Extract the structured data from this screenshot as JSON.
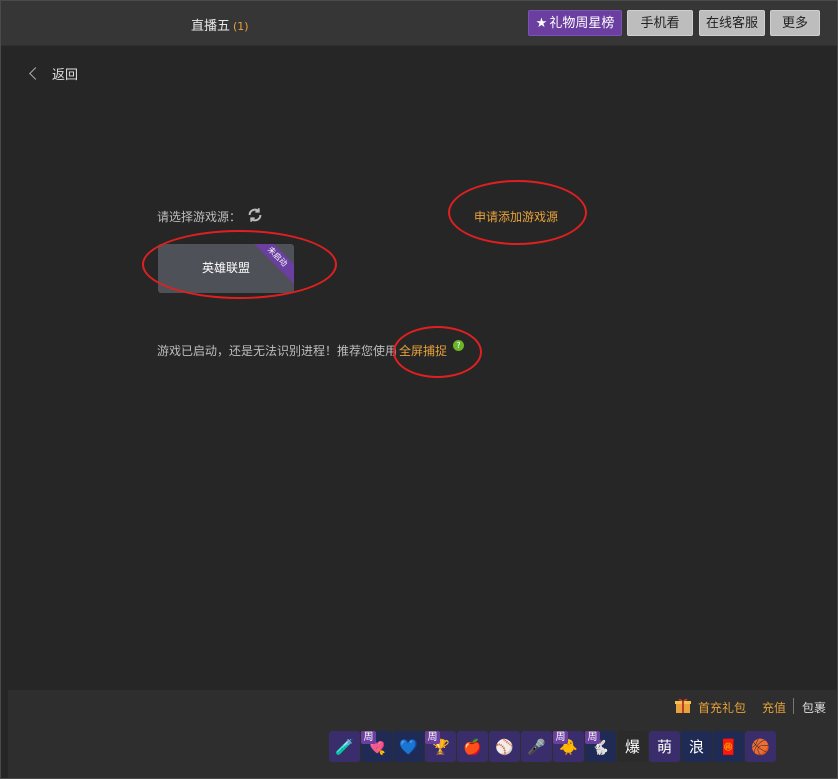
{
  "header": {
    "title": "直播五",
    "viewer_count": "(1)",
    "buttons": {
      "gift_star": "礼物周星榜",
      "mobile": "手机看",
      "support": "在线客服",
      "more": "更多"
    }
  },
  "nav": {
    "back_label": "返回"
  },
  "game_source": {
    "label": "请选择游戏源：",
    "apply_link": "申请添加游戏源",
    "card": {
      "name": "英雄联盟",
      "status_ribbon": "未启动"
    },
    "hint_text": "游戏已启动，还是无法识别进程！推荐您使用",
    "hint_link": "全屏捕捉",
    "hint_icon": "?"
  },
  "footer": {
    "first_recharge": "首充礼包",
    "recharge": "充值",
    "package": "包裹",
    "week_badge": "周",
    "items": [
      {
        "icon": "potion-icon",
        "glyph": "🧪",
        "bg": "#3a2d6b",
        "week": false
      },
      {
        "icon": "heart-arrow-icon",
        "glyph": "💘",
        "bg": "#1f2b55",
        "week": true
      },
      {
        "icon": "blue-bird-icon",
        "glyph": "💙",
        "bg": "#1f2b55",
        "week": false
      },
      {
        "icon": "trophy-icon",
        "glyph": "🏆",
        "bg": "#3a2d6b",
        "week": true
      },
      {
        "icon": "apple-icon",
        "glyph": "🍎",
        "bg": "#3a2d6b",
        "week": false
      },
      {
        "icon": "baseball-icon",
        "glyph": "⚾",
        "bg": "#3a2d6b",
        "week": false
      },
      {
        "icon": "microphone-icon",
        "glyph": "🎤",
        "bg": "#3a2d6b",
        "week": false
      },
      {
        "icon": "duck-icon",
        "glyph": "🐥",
        "bg": "#3a2d6b",
        "week": true
      },
      {
        "icon": "rabbit-moon-icon",
        "glyph": "🐇",
        "bg": "#1f2b55",
        "week": true
      },
      {
        "icon": "bomb-text-icon",
        "glyph": "爆",
        "bg": "#2b2b2b",
        "week": false
      },
      {
        "icon": "cute-rabbit-icon",
        "glyph": "萌",
        "bg": "#3a2d6b",
        "week": false
      },
      {
        "icon": "wave-text-icon",
        "glyph": "浪",
        "bg": "#1f2b55",
        "week": false
      },
      {
        "icon": "red-envelope-icon",
        "glyph": "🧧",
        "bg": "#1f2b55",
        "week": false
      },
      {
        "icon": "basketball-icon",
        "glyph": "🏀",
        "bg": "#3a2d6b",
        "week": false
      }
    ]
  }
}
